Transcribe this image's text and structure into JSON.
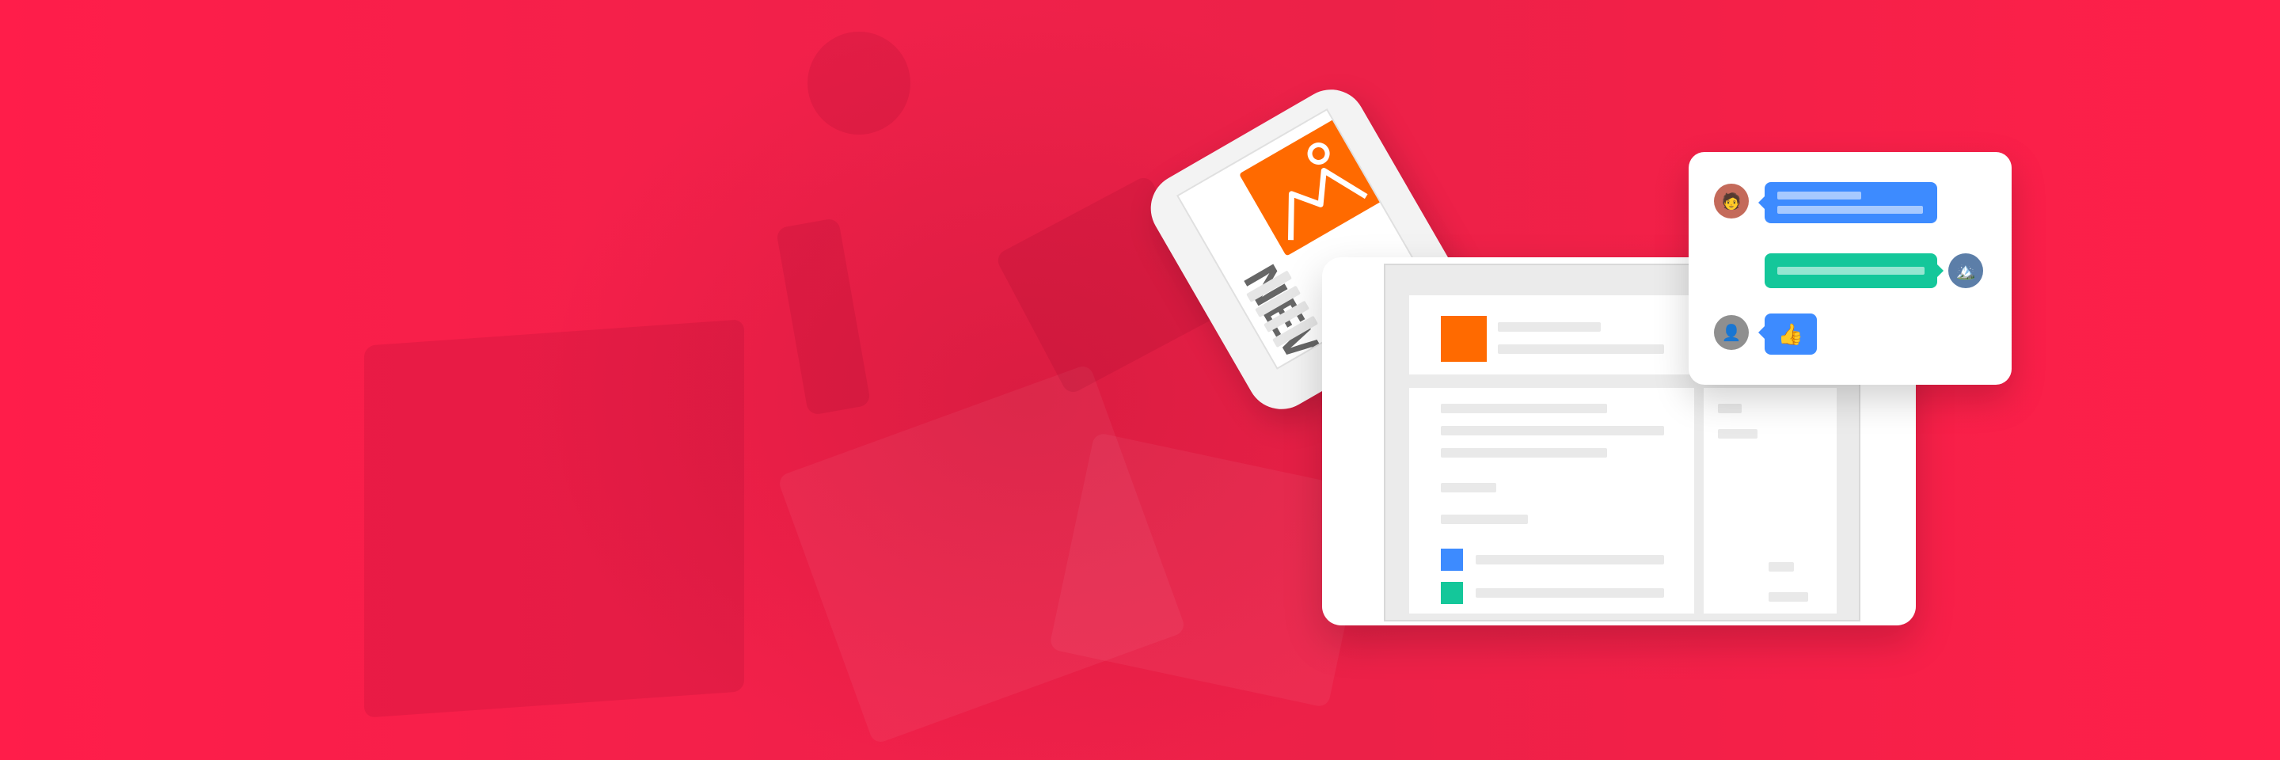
{
  "phone": {
    "heading": "NEWS"
  },
  "chat": {
    "reaction_emoji": "👍",
    "avatar_1_emoji": "🧑",
    "avatar_2_emoji": "🏔️",
    "avatar_3_emoji": "👤"
  },
  "colors": {
    "background": "#ff1e4a",
    "accent_orange": "#ff6a00",
    "bubble_blue": "#3d8bff",
    "bubble_green": "#14c79a",
    "placeholder_gray": "#e9e9e9"
  }
}
